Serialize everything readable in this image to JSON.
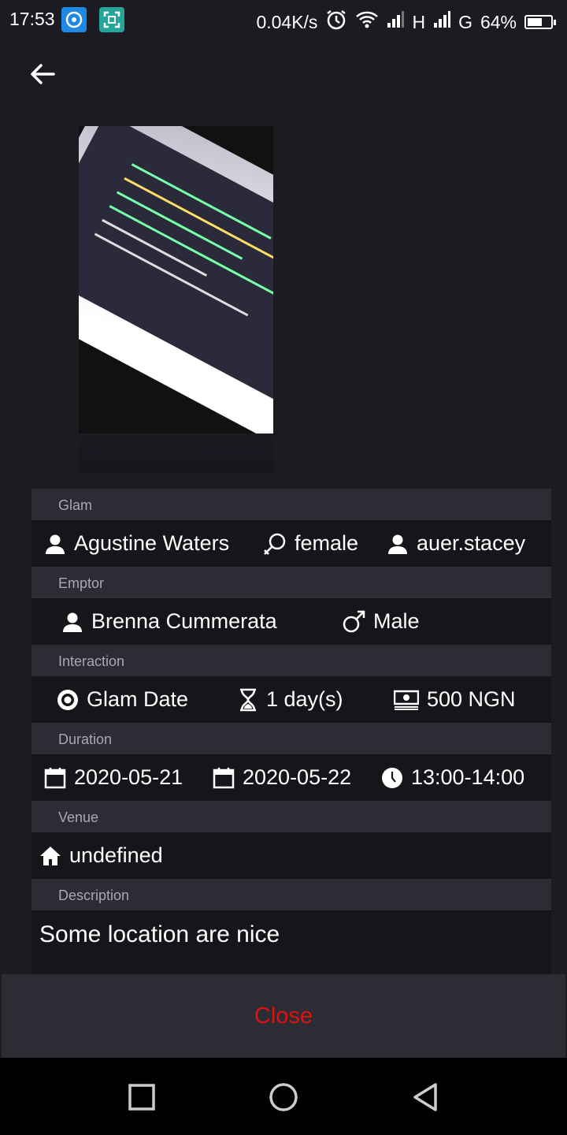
{
  "status_bar": {
    "time": "17:53",
    "net_speed": "0.04K/s",
    "signal_1": "H",
    "signal_2": "G",
    "battery": "64%",
    "battery_level": 0.64,
    "icons": [
      "app-notification-icon",
      "screenshot-icon",
      "alarm-icon",
      "wifi-icon",
      "signal-icon",
      "battery-icon"
    ]
  },
  "header": {
    "back_icon": "arrow-left-icon"
  },
  "photo": {
    "description_icon": "photo"
  },
  "sections": {
    "glam": {
      "label": "Glam",
      "name": "Agustine Waters",
      "gender": "female",
      "username": "auer.stacey"
    },
    "emptor": {
      "label": "Emptor",
      "name": "Brenna Cummerata",
      "gender": "Male"
    },
    "interaction": {
      "label": "Interaction",
      "type": "Glam Date",
      "duration": "1 day(s)",
      "price": "500 NGN"
    },
    "duration": {
      "label": "Duration",
      "start_date": "2020-05-21",
      "end_date": "2020-05-22",
      "time": "13:00-14:00"
    },
    "venue": {
      "label": "Venue",
      "value": "undefined"
    },
    "description": {
      "label": "Description",
      "value": "Some location are nice"
    }
  },
  "actions": {
    "close_label": "Close"
  },
  "colors": {
    "background": "#1b1b21",
    "header_bg": "#2c2c35",
    "row_bg": "#15151a",
    "close_text": "#e01010"
  }
}
